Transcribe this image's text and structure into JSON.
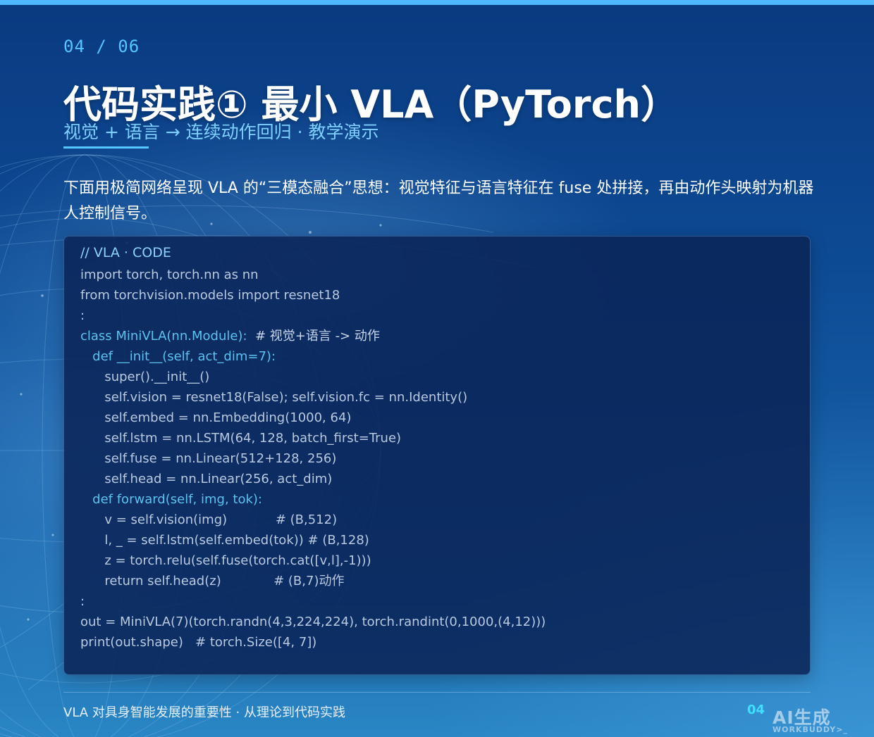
{
  "slide": {
    "counter": "04 / 06",
    "title": "代码实践① 最小 VLA（PyTorch）",
    "subtitle": "视觉 + 语言 → 连续动作回归 · 教学演示",
    "intro": "下面用极简网络呈现 VLA 的“三模态融合”思想：视觉特征与语言特征在 fuse 处拼接，再由动作头映射为机器人控制信号。"
  },
  "code": {
    "header": "// VLA · CODE",
    "lines": [
      {
        "text": "import torch, torch.nn as nn",
        "kind": "plain"
      },
      {
        "text": "from torchvision.models import resnet18",
        "kind": "plain"
      },
      {
        "text": ":",
        "kind": "plain"
      },
      {
        "text": "class MiniVLA(nn.Module):",
        "comment": "  # 视觉+语言 -> 动作",
        "kind": "kw"
      },
      {
        "text": "   def __init__(self, act_dim=7):",
        "kind": "kw"
      },
      {
        "text": "      super().__init__()",
        "kind": "plain"
      },
      {
        "text": "      self.vision = resnet18(False); self.vision.fc = nn.Identity()",
        "kind": "plain"
      },
      {
        "text": "      self.embed = nn.Embedding(1000, 64)",
        "kind": "plain"
      },
      {
        "text": "      self.lstm = nn.LSTM(64, 128, batch_first=True)",
        "kind": "plain"
      },
      {
        "text": "      self.fuse = nn.Linear(512+128, 256)",
        "kind": "plain"
      },
      {
        "text": "      self.head = nn.Linear(256, act_dim)",
        "kind": "plain"
      },
      {
        "text": "   def forward(self, img, tok):",
        "kind": "kw"
      },
      {
        "text": "      v = self.vision(img)            # (B,512)",
        "kind": "plain"
      },
      {
        "text": "      l, _ = self.lstm(self.embed(tok)) # (B,128)",
        "kind": "plain"
      },
      {
        "text": "      z = torch.relu(self.fuse(torch.cat([v,l],-1)))",
        "kind": "plain"
      },
      {
        "text": "      return self.head(z)             # (B,7)动作",
        "kind": "plain"
      },
      {
        "text": ":",
        "kind": "plain"
      },
      {
        "text": "out = MiniVLA(7)(torch.randn(4,3,224,224), torch.randint(0,1000,(4,12)))",
        "kind": "plain"
      },
      {
        "text": "print(out.shape)   # torch.Size([4, 7])",
        "kind": "plain"
      }
    ]
  },
  "footer": {
    "text": "VLA 对具身智能发展的重要性  ·  从理论到代码实践",
    "page": "04"
  },
  "watermark": {
    "main": "AI生成",
    "sub": "WORKBUDDY>_"
  },
  "colors": {
    "accent": "#56c4ff",
    "footer_page": "#3fe0ff",
    "code_keyword": "#5dc2f0",
    "code_text": "#b9c9df"
  }
}
